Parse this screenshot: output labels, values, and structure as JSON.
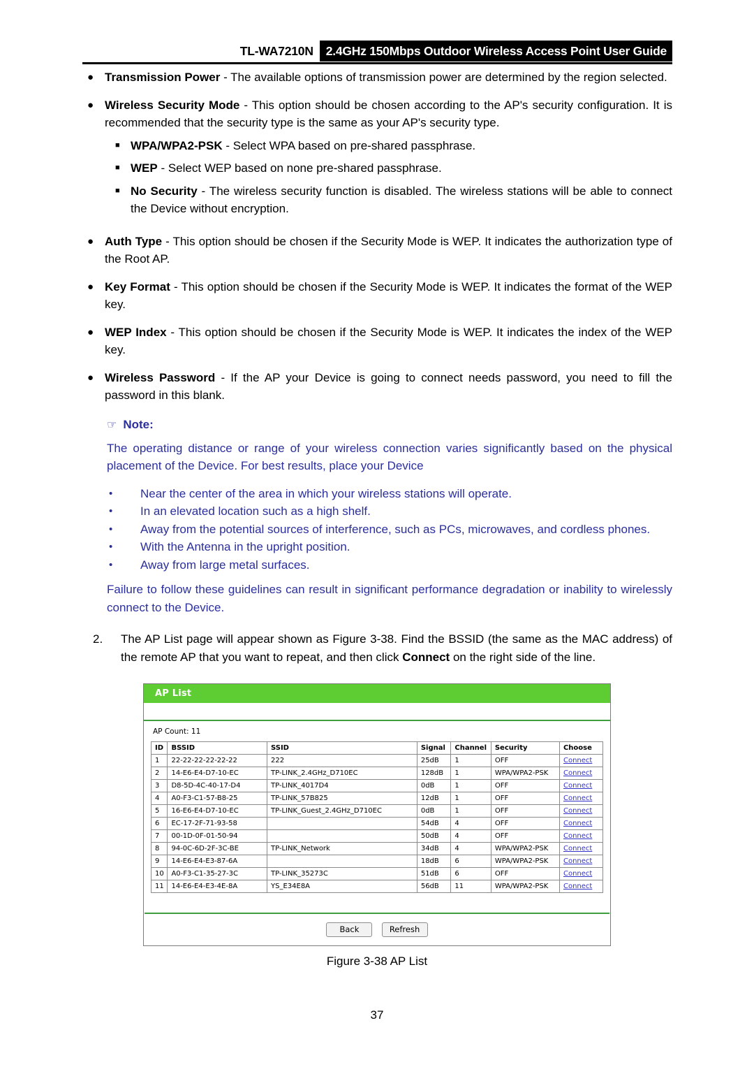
{
  "header": {
    "model": "TL-WA7210N",
    "guide_title": "2.4GHz 150Mbps Outdoor Wireless Access Point User Guide"
  },
  "bullets": [
    {
      "marker": "●",
      "term": "Transmission Power",
      "text": " - The available options of transmission power are determined by the region selected."
    },
    {
      "marker": "●",
      "term": "Wireless Security Mode",
      "text": " - This option should be chosen according to the AP's security configuration. It is recommended that the security type is the same as your AP's security type.",
      "sub_items": [
        {
          "marker": "■",
          "term": "WPA/WPA2-PSK",
          "text": " - Select WPA based on pre-shared passphrase."
        },
        {
          "marker": "■",
          "term": "WEP",
          "text": " - Select WEP based on none pre-shared passphrase."
        },
        {
          "marker": "■",
          "term": "No Security",
          "text": " - The wireless security function is disabled. The wireless stations will be able to connect the Device without encryption."
        }
      ]
    },
    {
      "marker": "●",
      "term": "Auth Type",
      "text": " - This option should be chosen if the Security Mode is WEP. It indicates the authorization type of the Root AP."
    },
    {
      "marker": "●",
      "term": "Key Format",
      "text": " - This option should be chosen if the Security Mode is WEP. It indicates the format of the WEP key."
    },
    {
      "marker": "●",
      "term": "WEP Index",
      "text": " - This option should be chosen if the Security Mode is WEP. It indicates the index of the WEP key."
    },
    {
      "marker": "●",
      "term": "Wireless Password",
      "text": " - If the AP your Device is going to connect needs password, you need to fill the password in this blank."
    }
  ],
  "note": {
    "hand_icon": "☞",
    "title": "Note:",
    "color": "#2b2f9c",
    "paragraph": "The operating distance or range of your wireless connection varies significantly based on the physical placement of the Device. For best results, place your Device",
    "bullet_marker": "•",
    "items": [
      "Near the center of the area in which your wireless stations will operate.",
      "In an elevated location such as a high shelf.",
      "Away from the potential sources of interference, such as PCs, microwaves, and cordless phones.",
      "With the Antenna in the upright position.",
      "Away from large metal surfaces."
    ],
    "tail": "Failure to follow these guidelines can result in significant performance degradation or inability to wirelessly connect to the Device."
  },
  "step": {
    "number": "2.",
    "text_before": "The AP List page will appear shown as Figure 3-38. Find the BSSID (the same as the MAC address) of the remote AP that you want to repeat, and then click ",
    "bold_word": "Connect",
    "text_after": " on the right side of the line."
  },
  "ap_list": {
    "panel_title": "AP List",
    "title_bar_color": "#5ecc33",
    "ap_count_label": "AP Count: 11",
    "columns": [
      "ID",
      "BSSID",
      "SSID",
      "Signal",
      "Channel",
      "Security",
      "Choose"
    ],
    "connect_label": "Connect",
    "connect_color": "#3333cc",
    "rows": [
      {
        "id": "1",
        "bssid": "22-22-22-22-22-22",
        "ssid": "222",
        "signal": "25dB",
        "channel": "1",
        "security": "OFF"
      },
      {
        "id": "2",
        "bssid": "14-E6-E4-D7-10-EC",
        "ssid": "TP-LINK_2.4GHz_D710EC",
        "signal": "128dB",
        "channel": "1",
        "security": "WPA/WPA2-PSK"
      },
      {
        "id": "3",
        "bssid": "D8-5D-4C-40-17-D4",
        "ssid": "TP-LINK_4017D4",
        "signal": "0dB",
        "channel": "1",
        "security": "OFF"
      },
      {
        "id": "4",
        "bssid": "A0-F3-C1-57-B8-25",
        "ssid": "TP-LINK_57B825",
        "signal": "12dB",
        "channel": "1",
        "security": "OFF"
      },
      {
        "id": "5",
        "bssid": "16-E6-E4-D7-10-EC",
        "ssid": "TP-LINK_Guest_2.4GHz_D710EC",
        "signal": "0dB",
        "channel": "1",
        "security": "OFF"
      },
      {
        "id": "6",
        "bssid": "EC-17-2F-71-93-58",
        "ssid": "",
        "signal": "54dB",
        "channel": "4",
        "security": "OFF"
      },
      {
        "id": "7",
        "bssid": "00-1D-0F-01-50-94",
        "ssid": "",
        "signal": "50dB",
        "channel": "4",
        "security": "OFF"
      },
      {
        "id": "8",
        "bssid": "94-0C-6D-2F-3C-BE",
        "ssid": "TP-LINK_Network",
        "signal": "34dB",
        "channel": "4",
        "security": "WPA/WPA2-PSK"
      },
      {
        "id": "9",
        "bssid": "14-E6-E4-E3-87-6A",
        "ssid": "",
        "signal": "18dB",
        "channel": "6",
        "security": "WPA/WPA2-PSK"
      },
      {
        "id": "10",
        "bssid": "A0-F3-C1-35-27-3C",
        "ssid": "TP-LINK_35273C",
        "signal": "51dB",
        "channel": "6",
        "security": "OFF"
      },
      {
        "id": "11",
        "bssid": "14-E6-E4-E3-4E-8A",
        "ssid": "YS_E34E8A",
        "signal": "56dB",
        "channel": "11",
        "security": "WPA/WPA2-PSK"
      }
    ],
    "buttons": [
      {
        "label": "Back"
      },
      {
        "label": "Refresh"
      }
    ]
  },
  "figure_caption": "Figure 3-38 AP List",
  "page_number": "37"
}
